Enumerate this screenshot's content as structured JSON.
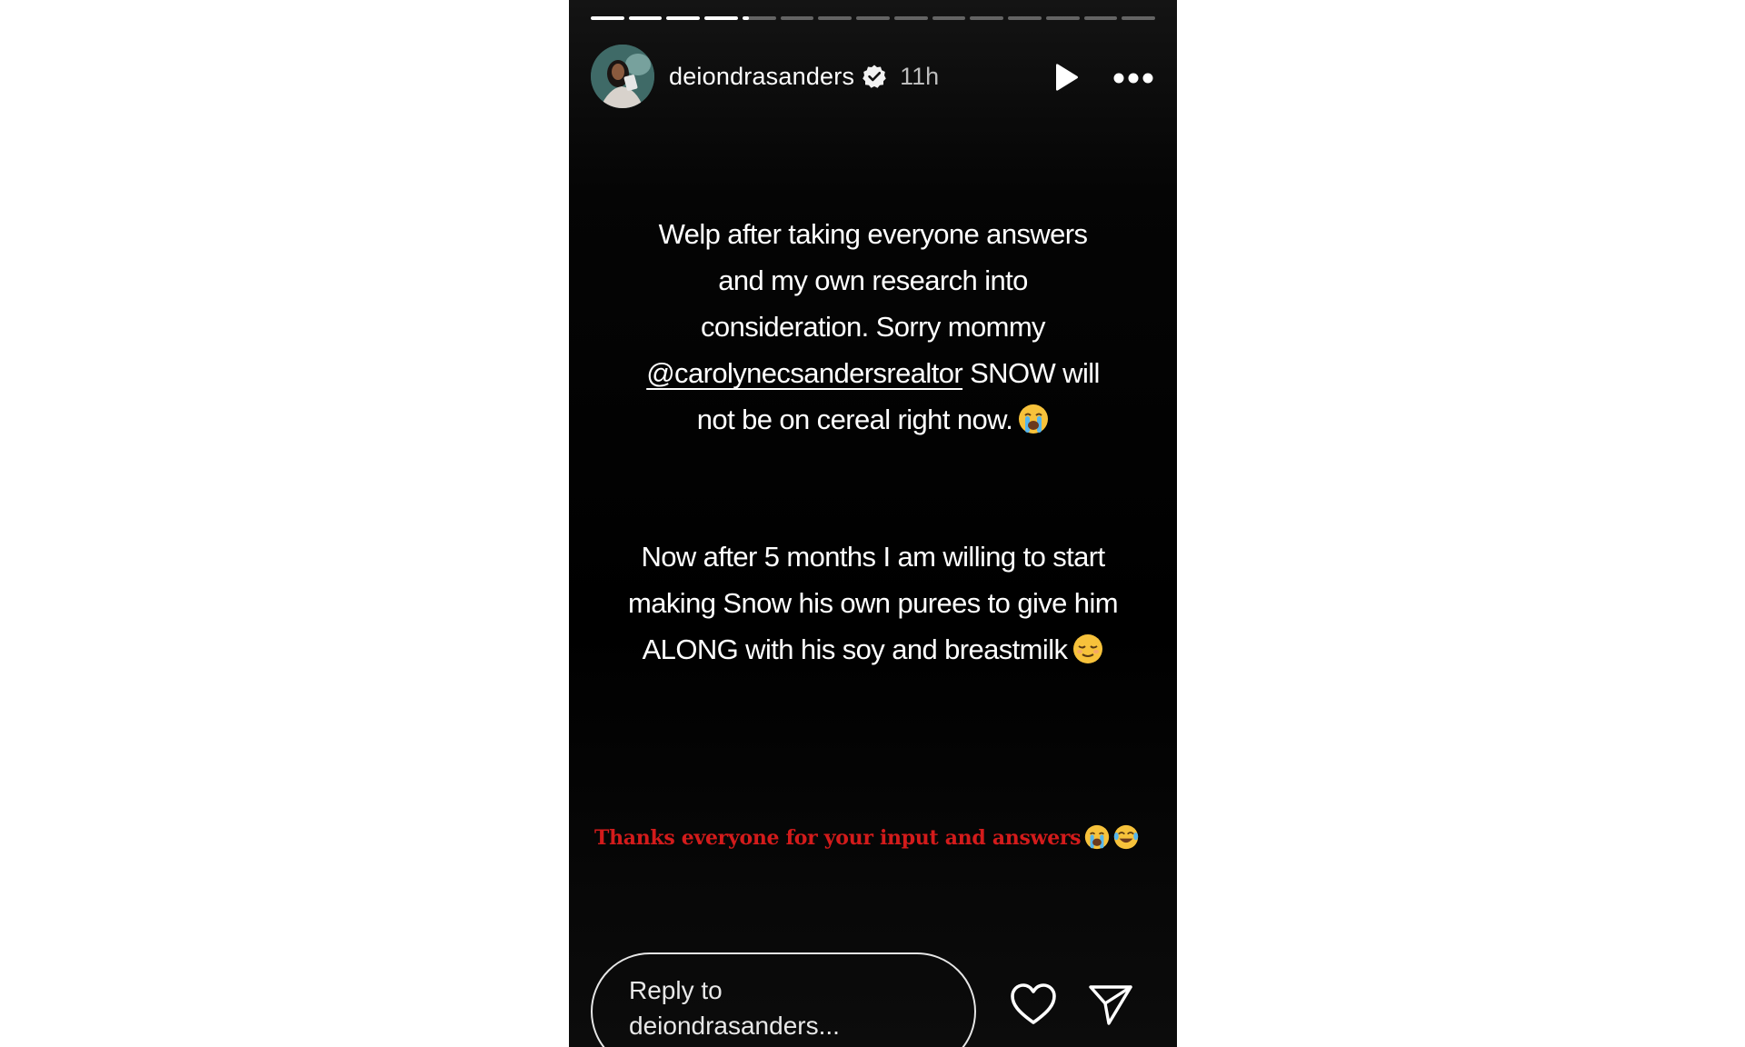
{
  "story": {
    "progress": {
      "segment_count": 15,
      "completed_segments": 4,
      "current_segment_fraction": 0.2
    },
    "header": {
      "username": "deiondrasanders",
      "verified": true,
      "time": "11h",
      "icons": {
        "avatar": "profile-photo",
        "verified": "verified-badge-icon",
        "play": "play-icon",
        "more": "more-options-icon"
      }
    },
    "caption1": {
      "line1": "Welp after taking everyone answers",
      "line2": "and my own research into",
      "line3": "consideration. Sorry mommy",
      "mention": "@carolynecsandersrealtor",
      "line4_rest": " SNOW will",
      "line5": "not be on cereal right now."
    },
    "caption2": {
      "line1": "Now after 5 months I am willing to start",
      "line2": "making Snow his own purees to give him",
      "line3": "ALONG with his soy and breastmilk"
    },
    "thanks": {
      "text": "Thanks everyone for your input and answers",
      "color": "#d31b1b"
    },
    "footer": {
      "reply_placeholder_line1": "Reply to",
      "reply_placeholder_line2": "deiondrasanders...",
      "icons": {
        "like": "heart-icon",
        "share": "send-icon"
      }
    }
  },
  "colors": {
    "page_background": "#ffffff",
    "story_background": "#000000",
    "text": "#ffffff",
    "accent_red": "#d31b1b",
    "emoji_yellow": "#f7c23b"
  }
}
